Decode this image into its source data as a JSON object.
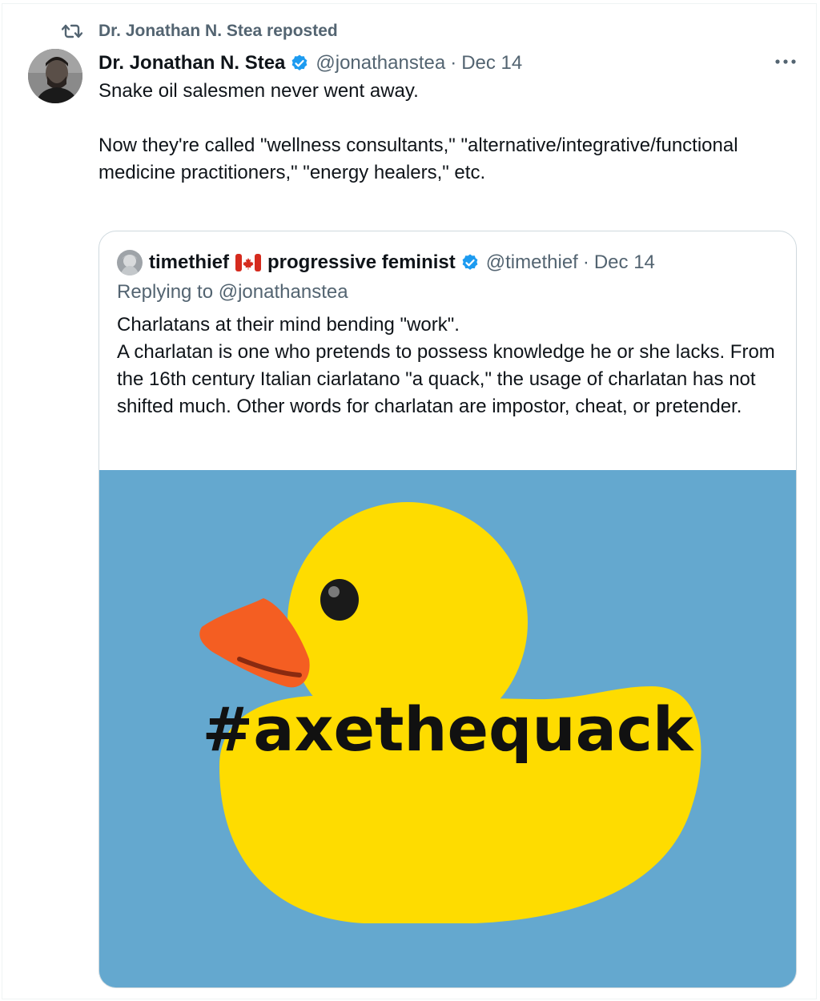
{
  "repost": {
    "label": "Dr. Jonathan N. Stea reposted",
    "icon": "repost-icon"
  },
  "tweet": {
    "author_name": "Dr. Jonathan N. Stea",
    "handle": "@jonathanstea",
    "separator": "·",
    "date": "Dec 14",
    "text_line1": "Snake oil salesmen never went away.",
    "text_para2": "Now they're called \"wellness consultants,\" \"alternative/integrative/functional medicine practitioners,\" \"energy healers,\" etc.",
    "more_icon": "more-icon",
    "verified_icon": "verified-badge-icon"
  },
  "quote": {
    "author_name": "timethief",
    "flag": "canada-flag-icon",
    "author_suffix": "progressive feminist",
    "handle": "@timethief",
    "separator": "·",
    "date": "Dec 14",
    "replying_to": "Replying to @jonathanstea",
    "line1": "Charlatans at their mind bending \"work\".",
    "line2": "A charlatan is one who pretends to possess knowledge he or she lacks.  From the 16th century Italian ciarlatano \"a quack,\" the usage of charlatan has not shifted much. Other words for charlatan are impostor,  cheat, or pretender.",
    "media": {
      "hashtag": "#axethequack",
      "background_color": "#64a8cf",
      "duck_color": "#fedc00",
      "beak_color": "#f45e22"
    }
  },
  "colors": {
    "text_primary": "#0f1419",
    "text_secondary": "#536471",
    "verified_blue": "#1d9bf0",
    "border": "#cfd9de"
  }
}
